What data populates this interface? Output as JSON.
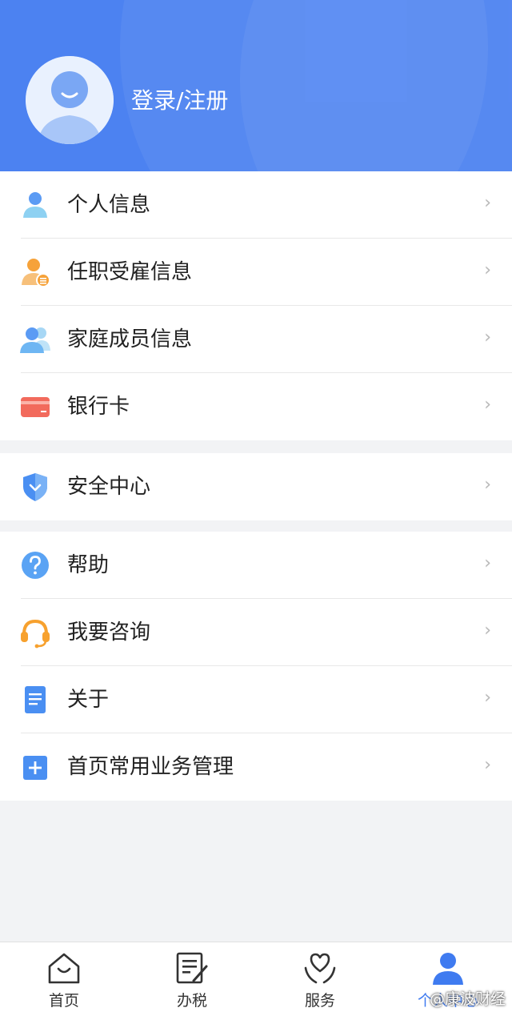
{
  "header": {
    "login_label": "登录/注册"
  },
  "menu": {
    "group1": [
      {
        "label": "个人信息",
        "icon": "person-icon"
      },
      {
        "label": "任职受雇信息",
        "icon": "employment-icon"
      },
      {
        "label": "家庭成员信息",
        "icon": "family-icon"
      },
      {
        "label": "银行卡",
        "icon": "bank-card-icon"
      }
    ],
    "group2": [
      {
        "label": "安全中心",
        "icon": "shield-icon"
      }
    ],
    "group3": [
      {
        "label": "帮助",
        "icon": "help-icon"
      },
      {
        "label": "我要咨询",
        "icon": "headset-icon"
      },
      {
        "label": "关于",
        "icon": "document-icon"
      },
      {
        "label": "首页常用业务管理",
        "icon": "plus-square-icon"
      }
    ],
    "chevron": "›"
  },
  "tabbar": [
    {
      "label": "首页",
      "icon": "home-icon"
    },
    {
      "label": "办税",
      "icon": "tax-form-icon"
    },
    {
      "label": "服务",
      "icon": "heart-hands-icon"
    },
    {
      "label": "个人中心",
      "icon": "user-center-icon",
      "active": true
    }
  ],
  "watermark": "@康波财经",
  "colors": {
    "primary": "#4c82f1",
    "active_tab": "#3f7bf0"
  }
}
